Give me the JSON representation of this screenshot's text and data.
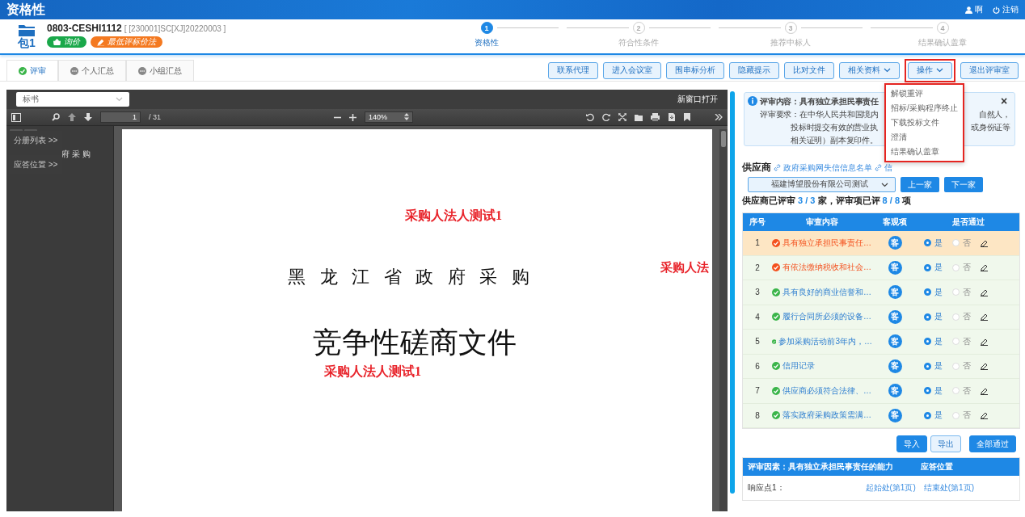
{
  "header": {
    "title": "资格性",
    "user": "啊",
    "logout": "注销"
  },
  "package": {
    "label": "包1",
    "code": "0803-CESHI1112",
    "project_no": "[ [230001]SC[XJ]20220003 ]",
    "tags": [
      {
        "kind": "procurement",
        "text": "询价",
        "color": "#1aa84a"
      },
      {
        "kind": "method",
        "text": "最低评标价法",
        "color": "#f47920"
      }
    ]
  },
  "steps": [
    {
      "number": "1",
      "label": "资格性",
      "selected": true
    },
    {
      "number": "2",
      "label": "符合性条件",
      "selected": false
    },
    {
      "number": "3",
      "label": "推荐中标人",
      "selected": false
    },
    {
      "number": "4",
      "label": "结果确认盖章",
      "selected": false
    }
  ],
  "tabs": [
    {
      "label": "评审",
      "completed": true,
      "selected": true
    },
    {
      "label": "个人汇总",
      "completed": false,
      "selected": false
    },
    {
      "label": "小组汇总",
      "completed": false,
      "selected": false
    }
  ],
  "toolbar": [
    {
      "label": "联系代理",
      "kind": "button",
      "highlighted": false
    },
    {
      "label": "进入会议室",
      "kind": "button",
      "highlighted": false
    },
    {
      "label": "围串标分析",
      "kind": "button",
      "highlighted": false
    },
    {
      "label": "隐藏提示",
      "kind": "button",
      "highlighted": false
    },
    {
      "label": "比对文件",
      "kind": "button",
      "highlighted": false
    },
    {
      "label": "相关资料",
      "kind": "dropdown",
      "highlighted": false
    },
    {
      "label": "操作",
      "kind": "dropdown",
      "highlighted": true
    },
    {
      "label": "退出评审室",
      "kind": "button",
      "highlighted": false
    }
  ],
  "menu": {
    "highlighted": true,
    "items": [
      "解锁重评",
      "招标/采购程序终止",
      "下载投标文件",
      "澄清",
      "结果确认盖章"
    ]
  },
  "viewer": {
    "document_select": "标书",
    "open_new_window": "新窗口打开",
    "page": "1",
    "page_total": "/ 31",
    "zoom": "140%",
    "panel_buttons": [
      "分册列表 >>",
      "应答位置 >>"
    ],
    "outline_item": "府 采 购",
    "page_texts": [
      {
        "kind": "stamp",
        "text": "采购人法人测试1"
      },
      {
        "kind": "heading",
        "text": "黑 龙 江 省 政 府 采 购"
      },
      {
        "kind": "stamp",
        "text": "采购人法"
      },
      {
        "kind": "title",
        "text": "竞争性磋商文件"
      },
      {
        "kind": "stamp",
        "text": "采购人法人测试1"
      }
    ]
  },
  "notice": {
    "close": "×",
    "lines": [
      {
        "left": "评审内容：具有独立承担民事责任"
      },
      {
        "left": "评审要求：在中华人民共和国境内",
        "right": "自然人，"
      },
      {
        "left": "投标时提交有效的营业执",
        "right": "或身份证等"
      },
      {
        "left": "相关证明）副本复印件。"
      }
    ]
  },
  "supplier": {
    "label": "供应商",
    "links": [
      "政府采购网失信信息名单",
      "信"
    ],
    "selected_supplier": "福建博望股份有限公司测试",
    "prev": "上一家",
    "next": "下一家"
  },
  "progress": [
    {
      "kind": "text",
      "text": "供应商已评审 "
    },
    {
      "kind": "count",
      "text": "3 / 3"
    },
    {
      "kind": "text",
      "text": " 家，评审项已评 "
    },
    {
      "kind": "count",
      "text": "8 / 8"
    },
    {
      "kind": "text",
      "text": " 项"
    }
  ],
  "table": {
    "columns": [
      "序号",
      "审查内容",
      "客观项",
      "是否通过"
    ],
    "rows": [
      {
        "no": "1",
        "content": "具有独立承担民事责任…",
        "flagged": true,
        "selected": true,
        "objective": "客",
        "yes": "是",
        "no_label": "否",
        "passed": true
      },
      {
        "no": "2",
        "content": "有依法缴纳税收和社会…",
        "flagged": true,
        "selected": false,
        "objective": "客",
        "yes": "是",
        "no_label": "否",
        "passed": true
      },
      {
        "no": "3",
        "content": "具有良好的商业信誉和…",
        "flagged": false,
        "selected": false,
        "objective": "客",
        "yes": "是",
        "no_label": "否",
        "passed": true
      },
      {
        "no": "4",
        "content": "履行合同所必须的设备…",
        "flagged": false,
        "selected": false,
        "objective": "客",
        "yes": "是",
        "no_label": "否",
        "passed": true
      },
      {
        "no": "5",
        "content": "参加采购活动前3年内，…",
        "flagged": false,
        "selected": false,
        "objective": "客",
        "yes": "是",
        "no_label": "否",
        "passed": true
      },
      {
        "no": "6",
        "content": "信用记录",
        "flagged": false,
        "selected": false,
        "objective": "客",
        "yes": "是",
        "no_label": "否",
        "passed": true
      },
      {
        "no": "7",
        "content": "供应商必须符合法律、…",
        "flagged": false,
        "selected": false,
        "objective": "客",
        "yes": "是",
        "no_label": "否",
        "passed": true
      },
      {
        "no": "8",
        "content": "落实政府采购政策需满…",
        "flagged": false,
        "selected": false,
        "objective": "客",
        "yes": "是",
        "no_label": "否",
        "passed": true
      }
    ]
  },
  "actions": [
    {
      "label": "导入",
      "kind": "primary"
    },
    {
      "label": "导出",
      "kind": "secondary"
    },
    {
      "label": "全部通过",
      "kind": "primary"
    }
  ],
  "response_table": {
    "factor": "评审因素：具有独立承担民事责任的能力",
    "position_header": "应答位置",
    "rows": [
      {
        "point": "响应点1：",
        "start": "起始处(第1页)",
        "end": "结束处(第1页)"
      }
    ]
  }
}
